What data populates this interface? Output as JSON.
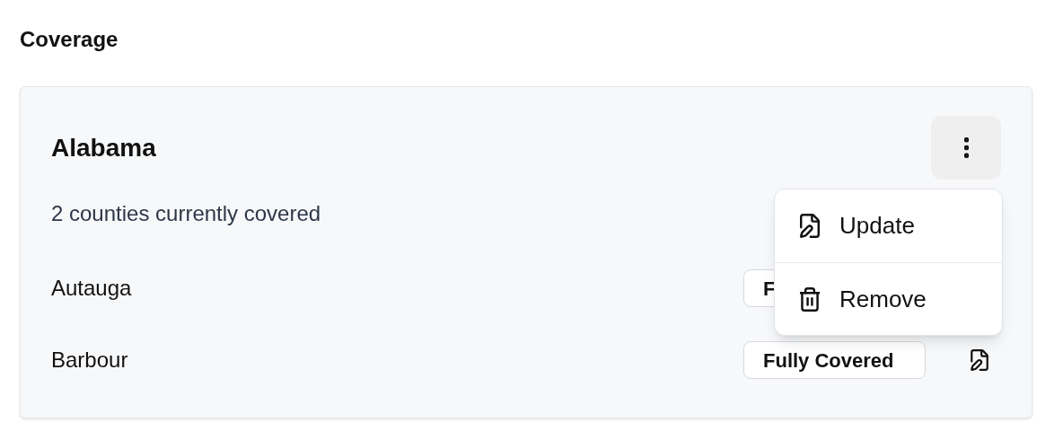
{
  "section_title": "Coverage",
  "card": {
    "title": "Alabama",
    "subtitle": "2 counties currently covered",
    "rows": [
      {
        "name": "Autauga",
        "badge": "F"
      },
      {
        "name": "Barbour",
        "badge": "Fully Covered",
        "edit_icon": true
      }
    ]
  },
  "menu": {
    "open": true,
    "items": [
      {
        "kind": "update",
        "label": "Update"
      },
      {
        "kind": "remove",
        "label": "Remove"
      }
    ]
  }
}
